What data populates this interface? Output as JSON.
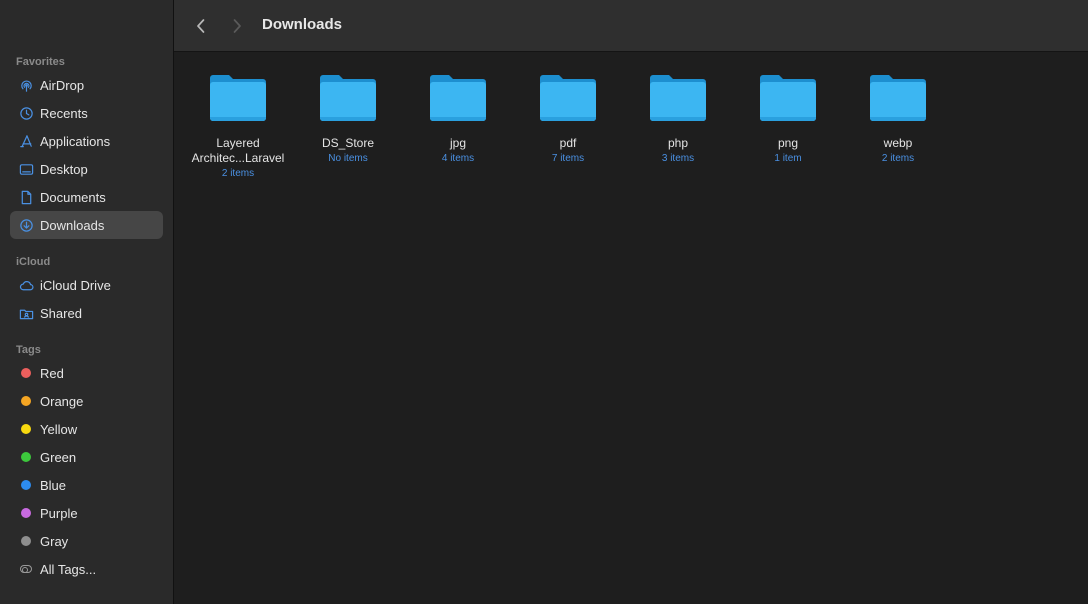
{
  "sidebar": {
    "favorites_header": "Favorites",
    "favorites": [
      {
        "label": "AirDrop",
        "icon": "airdrop-icon"
      },
      {
        "label": "Recents",
        "icon": "clock-icon"
      },
      {
        "label": "Applications",
        "icon": "applications-icon"
      },
      {
        "label": "Desktop",
        "icon": "desktop-icon"
      },
      {
        "label": "Documents",
        "icon": "document-icon"
      },
      {
        "label": "Downloads",
        "icon": "download-icon",
        "selected": true
      }
    ],
    "icloud_header": "iCloud",
    "icloud": [
      {
        "label": "iCloud Drive",
        "icon": "cloud-icon"
      },
      {
        "label": "Shared",
        "icon": "shared-folder-icon"
      }
    ],
    "tags_header": "Tags",
    "tags": [
      {
        "label": "Red",
        "color": "#ec5f5d"
      },
      {
        "label": "Orange",
        "color": "#f5a623"
      },
      {
        "label": "Yellow",
        "color": "#f8d90f"
      },
      {
        "label": "Green",
        "color": "#3cc83c"
      },
      {
        "label": "Blue",
        "color": "#2d8cf0"
      },
      {
        "label": "Purple",
        "color": "#c86ae0"
      },
      {
        "label": "Gray",
        "color": "#8e8e8e"
      },
      {
        "label": "All Tags...",
        "icon": "all-tags-icon"
      }
    ]
  },
  "toolbar": {
    "title": "Downloads",
    "back_icon": "chevron-left-icon",
    "forward_icon": "chevron-right-icon"
  },
  "items": [
    {
      "name": "Layered Architec...Laravel",
      "count": "2 items"
    },
    {
      "name": "DS_Store",
      "count": "No items"
    },
    {
      "name": "jpg",
      "count": "4 items"
    },
    {
      "name": "pdf",
      "count": "7 items"
    },
    {
      "name": "php",
      "count": "3 items"
    },
    {
      "name": "png",
      "count": "1 item"
    },
    {
      "name": "webp",
      "count": "2 items"
    }
  ],
  "colors": {
    "accent": "#4a90e2",
    "folder": "#39b6f0"
  }
}
